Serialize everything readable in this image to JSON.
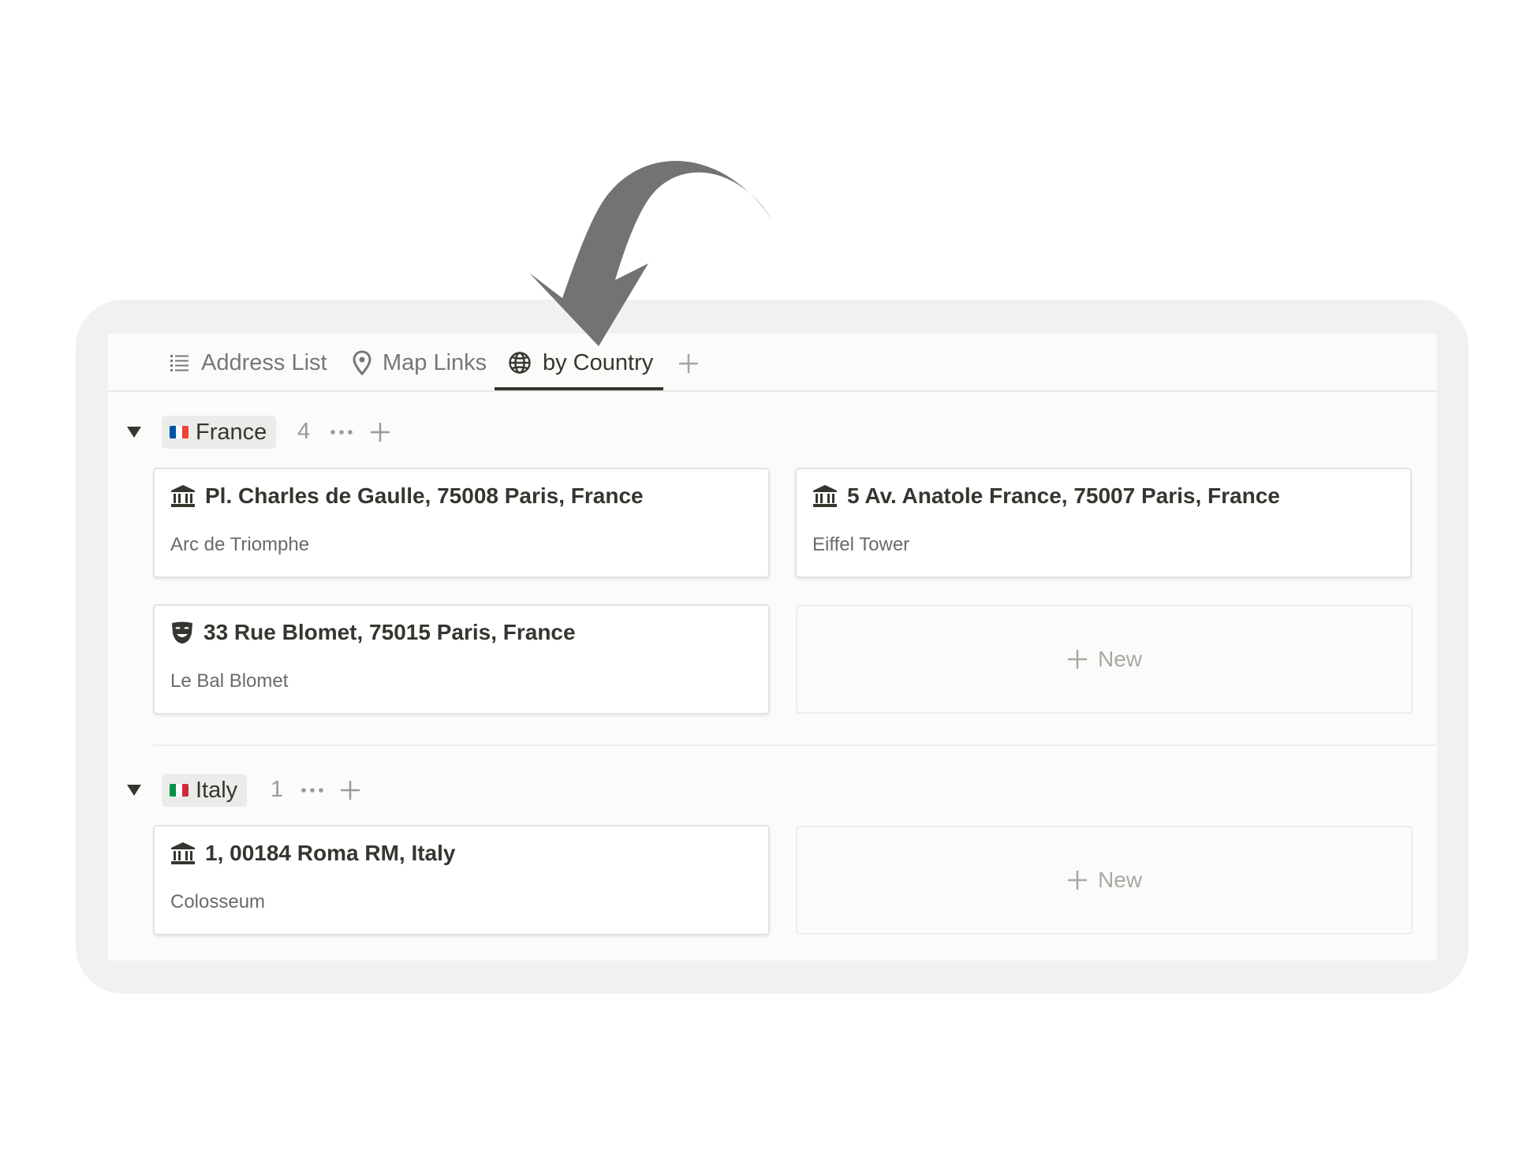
{
  "tabs": [
    {
      "label": "Address List",
      "icon": "list-icon"
    },
    {
      "label": "Map Links",
      "icon": "map-pin-icon"
    },
    {
      "label": "by Country",
      "icon": "globe-icon",
      "active": true
    }
  ],
  "groups": [
    {
      "name": "France",
      "count": "4",
      "flag_colors": [
        "#0055a4",
        "#ffffff",
        "#ef4135"
      ],
      "cards": [
        {
          "title": "Pl. Charles de Gaulle, 75008 Paris, France",
          "subtitle": "Arc de Triomphe",
          "icon": "museum-icon"
        },
        {
          "title": "5 Av. Anatole France, 75007 Paris, France",
          "subtitle": "Eiffel Tower",
          "icon": "museum-icon"
        },
        {
          "title": "33 Rue Blomet, 75015 Paris, France",
          "subtitle": "Le Bal Blomet",
          "icon": "theater-mask-icon"
        }
      ],
      "new_label": "New"
    },
    {
      "name": "Italy",
      "count": "1",
      "flag_colors": [
        "#009246",
        "#ffffff",
        "#ce2b37"
      ],
      "cards": [
        {
          "title": "1, 00184 Roma RM, Italy",
          "subtitle": "Colosseum",
          "icon": "museum-icon"
        }
      ],
      "new_label": "New"
    }
  ],
  "colors": {
    "accent": "#37352f",
    "muted": "#787774",
    "arrow": "#737373"
  }
}
